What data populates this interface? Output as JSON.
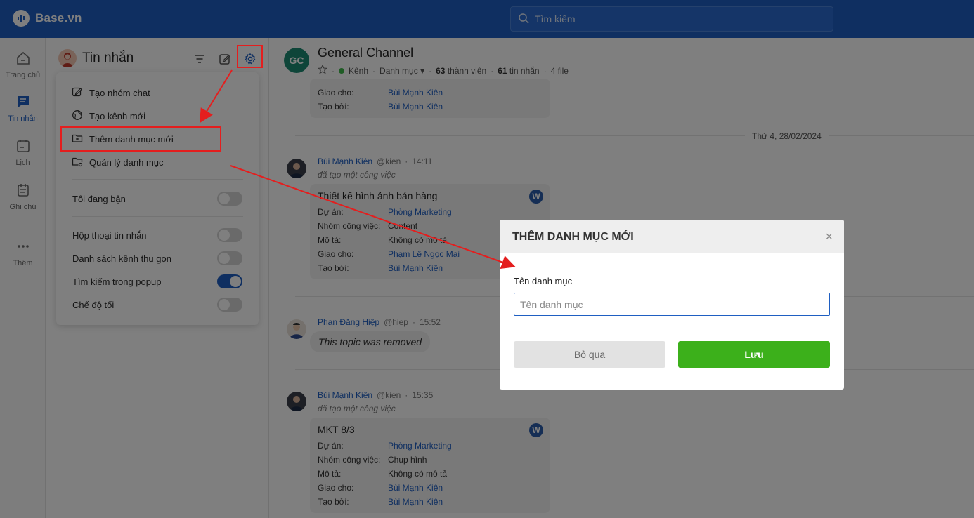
{
  "topbar": {
    "brand": "Base.vn",
    "search_placeholder": "Tìm kiếm"
  },
  "rail": {
    "items": [
      {
        "label": "Trang chủ",
        "icon": "home-icon"
      },
      {
        "label": "Tin nhắn",
        "icon": "chat-icon",
        "active": true
      },
      {
        "label": "Lịch",
        "icon": "calendar-icon"
      },
      {
        "label": "Ghi chú",
        "icon": "notes-icon"
      },
      {
        "label": "Thêm",
        "icon": "more-icon"
      }
    ]
  },
  "panel": {
    "title": "Tin nhắn"
  },
  "menu": {
    "actions": [
      {
        "label": "Tạo nhóm chat",
        "icon": "edit-icon"
      },
      {
        "label": "Tạo kênh mới",
        "icon": "globe-icon"
      },
      {
        "label": "Thêm danh mục mới",
        "icon": "folder-plus-icon"
      },
      {
        "label": "Quản lý danh mục",
        "icon": "folder-settings-icon"
      }
    ],
    "busy": {
      "label": "Tôi đang bận",
      "on": false
    },
    "toggles": [
      {
        "label": "Hộp thoại tin nhắn",
        "on": false
      },
      {
        "label": "Danh sách kênh thu gọn",
        "on": false
      },
      {
        "label": "Tìm kiếm trong popup",
        "on": true
      },
      {
        "label": "Chế độ tối",
        "on": false
      }
    ]
  },
  "chat": {
    "avatar_initials": "GC",
    "title": "General Channel",
    "meta": {
      "type": "Kênh",
      "category": "Danh mục",
      "members_count": "63",
      "members_label": "thành viên",
      "messages_count": "61",
      "messages_label": "tin nhắn",
      "files": "4 file"
    },
    "top_card": {
      "rows": [
        {
          "k": "Giao cho:",
          "v": "Bùi Mạnh Kiên"
        },
        {
          "k": "Tạo bởi:",
          "v": "Bùi Mạnh Kiên"
        }
      ]
    },
    "date_divider": "Thứ 4, 28/02/2024",
    "messages": [
      {
        "name": "Bùi Mạnh Kiên",
        "handle": "@kien",
        "time": "14:11",
        "sub": "đã tạo một công việc",
        "card": {
          "title": "Thiết kế hình ảnh bán hàng",
          "badge": "W",
          "rows": [
            {
              "k": "Dự án:",
              "v": "Phòng Marketing",
              "link": true
            },
            {
              "k": "Nhóm công việc:",
              "v": "Content",
              "link": false
            },
            {
              "k": "Mô tả:",
              "v": "Không có mô tả",
              "link": false
            },
            {
              "k": "Giao cho:",
              "v": "Phạm Lê Ngọc Mai",
              "link": true
            },
            {
              "k": "Tạo bởi:",
              "v": "Bùi Mạnh Kiên",
              "link": true
            }
          ]
        }
      },
      {
        "name": "Phan Đăng Hiệp",
        "handle": "@hiep",
        "time": "15:52",
        "bubble": "This topic was removed"
      },
      {
        "name": "Bùi Mạnh Kiên",
        "handle": "@kien",
        "time": "15:35",
        "sub": "đã tạo một công việc",
        "card": {
          "title": "MKT 8/3",
          "badge": "W",
          "rows": [
            {
              "k": "Dự án:",
              "v": "Phòng Marketing",
              "link": true
            },
            {
              "k": "Nhóm công việc:",
              "v": "Chụp hình",
              "link": false
            },
            {
              "k": "Mô tả:",
              "v": "Không có mô tả",
              "link": false
            },
            {
              "k": "Giao cho:",
              "v": "Bùi Mạnh Kiên",
              "link": true
            },
            {
              "k": "Tạo bởi:",
              "v": "Bùi Mạnh Kiên",
              "link": true
            }
          ]
        }
      }
    ]
  },
  "modal": {
    "title": "THÊM DANH MỤC MỚI",
    "close": "×",
    "field_label": "Tên danh mục",
    "field_placeholder": "Tên danh mục",
    "field_value": "",
    "cancel_label": "Bỏ qua",
    "save_label": "Lưu"
  },
  "colors": {
    "brand": "#1f5fc2",
    "save": "#3cb01b",
    "annotation": "#e41e1e"
  }
}
